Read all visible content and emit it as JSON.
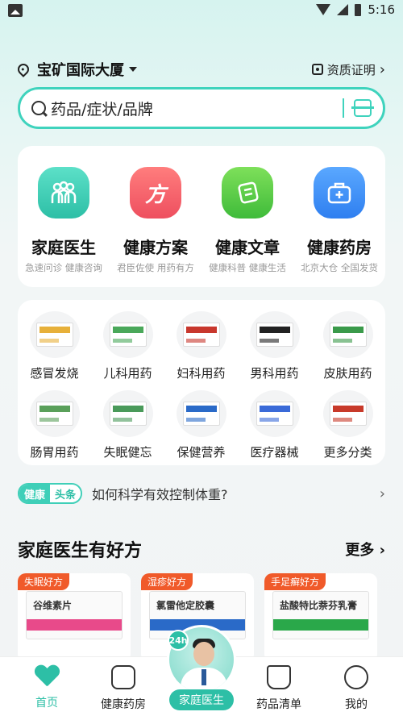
{
  "status_bar": {
    "time": "5:16"
  },
  "location": {
    "name": "宝矿国际大厦",
    "qualification": "资质证明"
  },
  "search": {
    "placeholder": "药品/症状/品牌"
  },
  "services": [
    {
      "title": "家庭医生",
      "subtitle": "急速问诊 健康咨询",
      "icon": "family-icon",
      "color": "#3fcfb8"
    },
    {
      "title": "健康方案",
      "subtitle": "君臣佐使 用药有方",
      "icon": "plan-icon",
      "color": "#f2636b",
      "glyph": "方"
    },
    {
      "title": "健康文章",
      "subtitle": "健康科普 健康生活",
      "icon": "article-icon",
      "color": "#5ccb4a"
    },
    {
      "title": "健康药房",
      "subtitle": "北京大仓 全国发货",
      "icon": "medicine-box-icon",
      "color": "#3f8ff0"
    }
  ],
  "categories": [
    {
      "label": "感冒发烧",
      "color": "#e7b03a"
    },
    {
      "label": "儿科用药",
      "color": "#4aa85a"
    },
    {
      "label": "妇科用药",
      "color": "#c8372d"
    },
    {
      "label": "男科用药",
      "color": "#222222"
    },
    {
      "label": "皮肤用药",
      "color": "#3a9a4a"
    },
    {
      "label": "肠胃用药",
      "color": "#5aa05a"
    },
    {
      "label": "失眠健忘",
      "color": "#4a9a5a"
    },
    {
      "label": "保健营养",
      "color": "#2a6ac8"
    },
    {
      "label": "医疗器械",
      "color": "#3a6ad8"
    },
    {
      "label": "更多分类",
      "color": "#c83a2a"
    }
  ],
  "news": {
    "badge_a": "健康",
    "badge_b": "头条",
    "text": "如何科学有效控制体重?"
  },
  "section": {
    "title": "家庭医生有好方",
    "more": "更多"
  },
  "products": [
    {
      "tag": "失眠好方",
      "name": "谷维素片",
      "band_color": "#e84a8a"
    },
    {
      "tag": "湿疹好方",
      "name": "氯雷他定胶囊",
      "band_color": "#2a6ac8"
    },
    {
      "tag": "手足癣好方",
      "name": "盐酸特比萘芬乳膏",
      "band_color": "#2aa84a"
    }
  ],
  "tabbar": {
    "tabs": [
      "首页",
      "健康药房",
      "家庭医生",
      "药品清单",
      "我的"
    ],
    "doctor_badge": "24h",
    "active_color": "#2dbfa6"
  }
}
